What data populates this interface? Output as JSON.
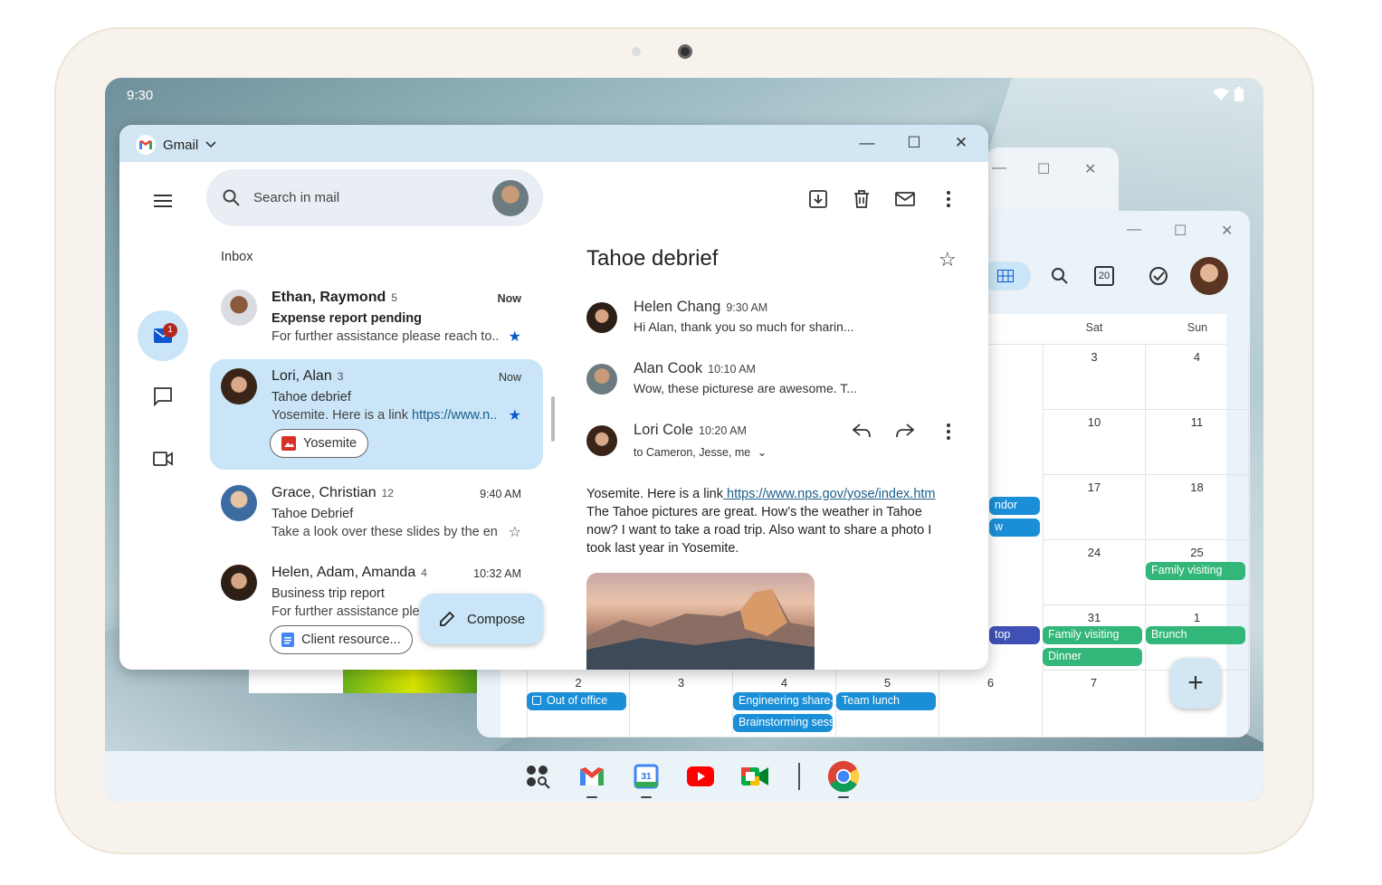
{
  "status": {
    "time": "9:30"
  },
  "gmail": {
    "app_name": "Gmail",
    "search_placeholder": "Search in mail",
    "inbox_label": "Inbox",
    "chat_badge": "1",
    "compose_label": "Compose",
    "mails": [
      {
        "from": "Ethan, Raymond",
        "count": "5",
        "time": "Now",
        "subject": "Expense report pending",
        "snippet": "For further assistance please reach to...",
        "starred": true
      },
      {
        "from": "Lori, Alan",
        "count": "3",
        "time": "Now",
        "subject": "Tahoe debrief",
        "snippet_prefix": "Yosemite. Here is a link ",
        "snippet_link": "https://www.n...",
        "chip": "Yosemite",
        "starred": true,
        "selected": true
      },
      {
        "from": "Grace, Christian",
        "count": "12",
        "time": "9:40 AM",
        "subject": "Tahoe Debrief",
        "snippet": "Take a look over these slides by the end",
        "starred": false
      },
      {
        "from": "Helen, Adam, Amanda",
        "count": "4",
        "time": "10:32 AM",
        "subject": "Business trip report",
        "snippet": "For further assistance please rea",
        "chip": "Client resource..."
      }
    ],
    "thread": {
      "subject": "Tahoe debrief",
      "messages": [
        {
          "name": "Helen Chang",
          "time": "9:30 AM",
          "preview": "Hi Alan, thank you so much for sharin..."
        },
        {
          "name": "Alan Cook",
          "time": "10:10 AM",
          "preview": "Wow, these picturese are awesome. T..."
        },
        {
          "name": "Lori Cole",
          "time": "10:20 AM",
          "to": "to Cameron, Jesse, me"
        }
      ],
      "body_prefix": "Yosemite. Here is a link",
      "body_link": " https://www.nps.gov/yose/index.htm",
      "body_rest": "The Tahoe pictures are great. How’s the weather in Tahoe now? I want to take a road trip. Also want to share a photo I took last year in Yosemite."
    }
  },
  "calendar": {
    "today_icon": "20",
    "days": [
      "Sat",
      "Sun"
    ],
    "rows": [
      {
        "sat": "3",
        "sun": "4"
      },
      {
        "sat": "10",
        "sun": "11"
      },
      {
        "sat": "17",
        "sun": "18"
      },
      {
        "sat": "24",
        "sun": "25"
      },
      {
        "sat": "31",
        "sun": "1"
      }
    ],
    "last_row": [
      "2",
      "3",
      "4",
      "5",
      "6",
      "7"
    ],
    "events": {
      "vendor_a": "ndor",
      "vendor_b": "w",
      "family_25": "Family visiting",
      "top": "top",
      "family_31": "Family visiting",
      "dinner": "Dinner",
      "brunch": "Brunch",
      "out_of_office": "Out of office",
      "engineering": "Engineering share-",
      "brainstorm": "Brainstorming sess",
      "team_lunch": "Team lunch"
    }
  },
  "colors": {
    "title_bar": "#d3e6f3",
    "selected_mail": "#c9e5f7",
    "event_blue": "#1a8fd8",
    "event_green": "#33b679"
  },
  "dock": [
    "launcher-icon",
    "gmail-icon",
    "calendar-icon",
    "youtube-icon",
    "meet-icon",
    "chrome-icon"
  ]
}
